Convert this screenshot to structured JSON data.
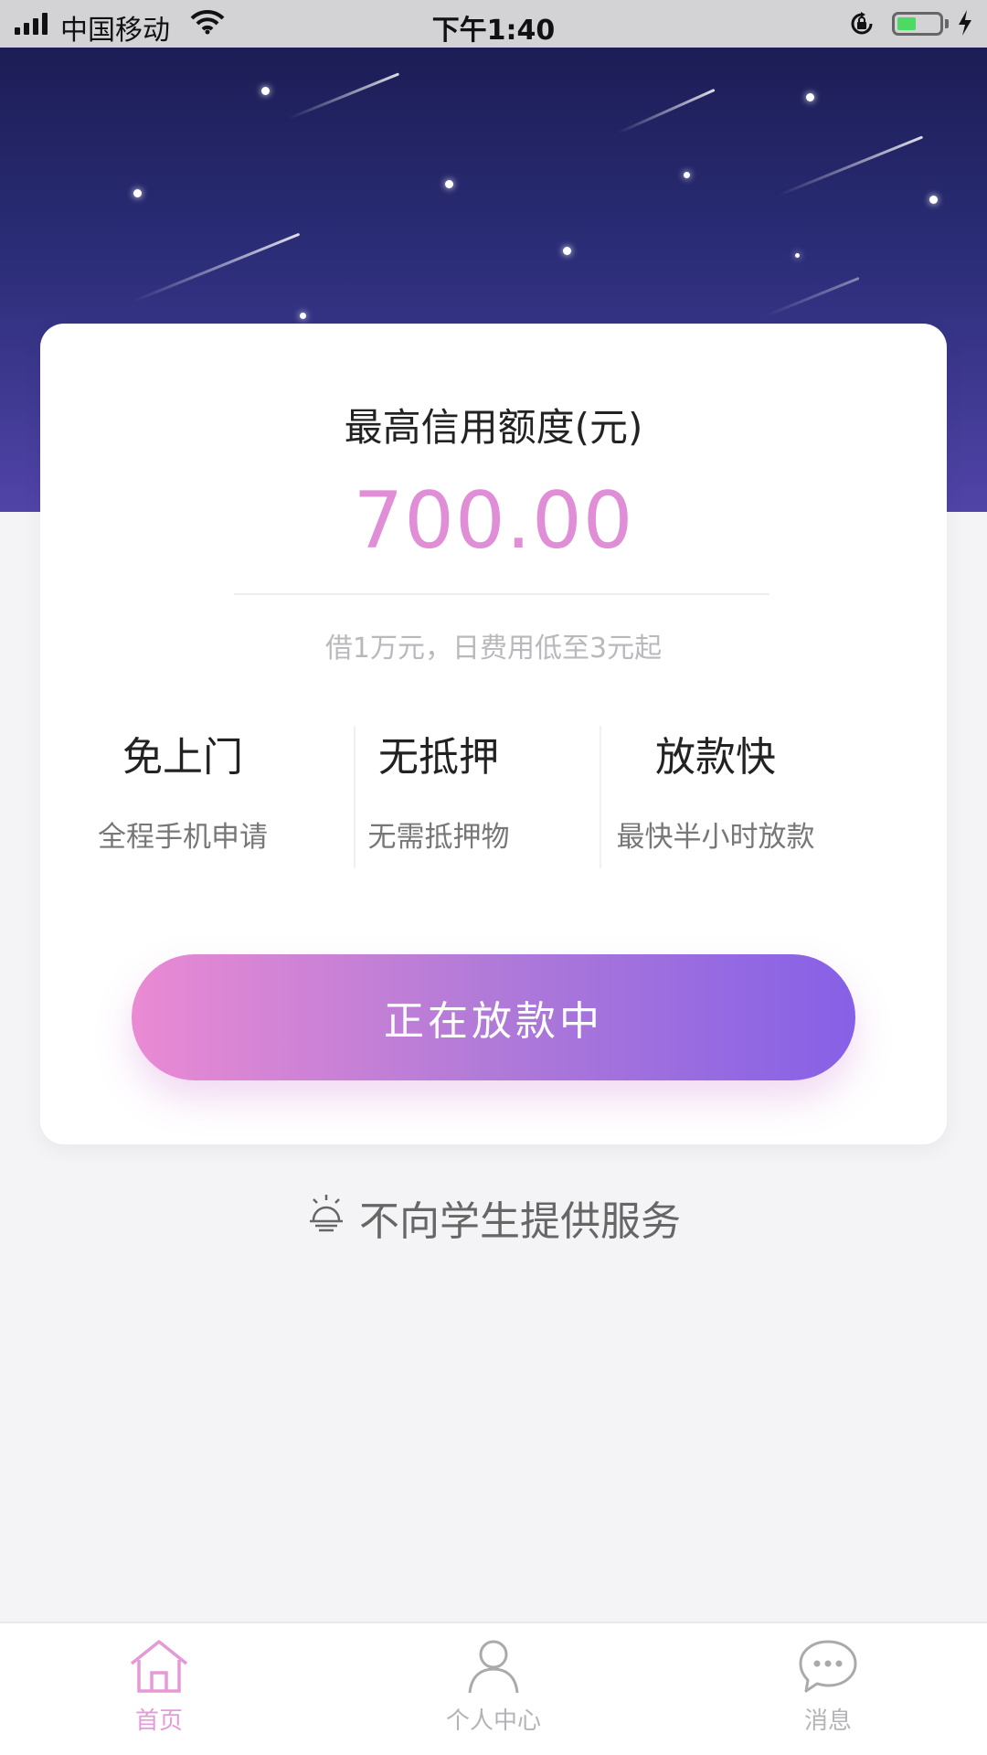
{
  "status_bar": {
    "carrier": "中国移动",
    "time": "下午1:40",
    "battery_level": 0.45
  },
  "card": {
    "title": "最高信用额度(元)",
    "amount": "700.00",
    "subtitle": "借1万元，日费用低至3元起",
    "features": [
      {
        "title": "免上门",
        "desc": "全程手机申请"
      },
      {
        "title": "无抵押",
        "desc": "无需抵押物"
      },
      {
        "title": "放款快",
        "desc": "最快半小时放款"
      }
    ],
    "button_label": "正在放款中"
  },
  "notice": {
    "text": "不向学生提供服务",
    "icon": "alarm-bell-icon"
  },
  "tabbar": {
    "items": [
      {
        "label": "首页",
        "icon": "home-icon",
        "active": true
      },
      {
        "label": "个人中心",
        "icon": "person-icon",
        "active": false
      },
      {
        "label": "消息",
        "icon": "chat-bubble-icon",
        "active": false
      }
    ]
  },
  "colors": {
    "accent_pink": "#e08ed6",
    "button_start": "#ea8ad3",
    "button_end": "#8660e6",
    "hero_top": "#1c1d55",
    "hero_bottom": "#5144a8"
  }
}
